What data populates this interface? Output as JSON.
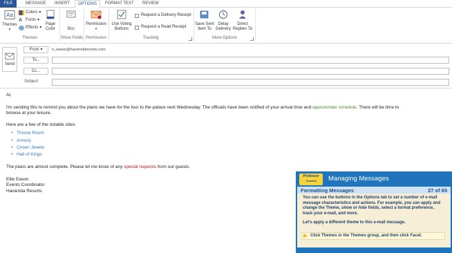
{
  "tabs": [
    "FILE",
    "MESSAGE",
    "INSERT",
    "OPTIONS",
    "FORMAT TEXT",
    "REVIEW"
  ],
  "ribbon": {
    "themes_group": {
      "themes_label": "Themes",
      "colors_label": "Colors",
      "fonts_label": "Fonts",
      "effects_label": "Effects",
      "page_color_label_1": "Page",
      "page_color_label_2": "Color",
      "group_label": "Themes"
    },
    "show_fields_group": {
      "bcc_label": "Bcc",
      "group_label": "Show Fields"
    },
    "permission_group": {
      "permission_label": "Permission",
      "group_label": "Permission"
    },
    "tracking_group": {
      "voting_label_1": "Use Voting",
      "voting_label_2": "Buttons",
      "delivery_receipt": "Request a Delivery Receipt",
      "read_receipt": "Request a Read Receipt",
      "group_label": "Tracking"
    },
    "more_options_group": {
      "save_sent_1": "Save Sent",
      "save_sent_2": "Item To",
      "delay_1": "Delay",
      "delay_2": "Delivery",
      "direct_1": "Direct",
      "direct_2": "Replies To",
      "group_label": "More Options"
    }
  },
  "compose": {
    "send_label": "Send",
    "from_label": "From",
    "from_value": "e_eason@haciendaresorts.com",
    "to_label": "To...",
    "cc_label": "Cc...",
    "subject_label": "Subject"
  },
  "message": {
    "greeting": "Al,",
    "para1_a": "I'm sending this to remind you about the plans we have for the tour to the palace next Wednesday. The officials have been notified of your arrival time and ",
    "para1_link": "approximate schedule",
    "para1_b": ". There will be time to",
    "para1_c": "browse at your leisure.",
    "sites_intro": "Here are a few of the notable sites:",
    "sites": [
      "Throne Room",
      "Armory",
      "Crown Jewels",
      "Hall of Kings"
    ],
    "para2_a": "The plans are almost complete. Please let me know of any ",
    "para2_link": "special requests",
    "para2_b": " from our guests.",
    "sig_name": "Ellie Eason",
    "sig_title": "Events Coordinator",
    "sig_company": "Hacienda Resorts"
  },
  "professor": {
    "logo_1": "Professor",
    "logo_2": "Teaches",
    "title": "Managing Messages",
    "section": "Formatting Messages",
    "page": "27 of 65",
    "text": "You can use the buttons in the Options tab to set a number of e-mail message characteristics and actions. For example, you can apply and change the Theme, show or hide fields, select a format preference, track your e-mail, and more.",
    "text2": "Let's apply a different theme to this e-mail message.",
    "action": "Click Themes in the Themes group, and then click Facet."
  },
  "colors": {
    "accent": "#2b579a",
    "green_link": "#4e8a2a",
    "red_link": "#c0141b",
    "blue_list": "#3575c0",
    "professor_blue": "#1f74bc",
    "professor_cream": "#f6eed6"
  }
}
